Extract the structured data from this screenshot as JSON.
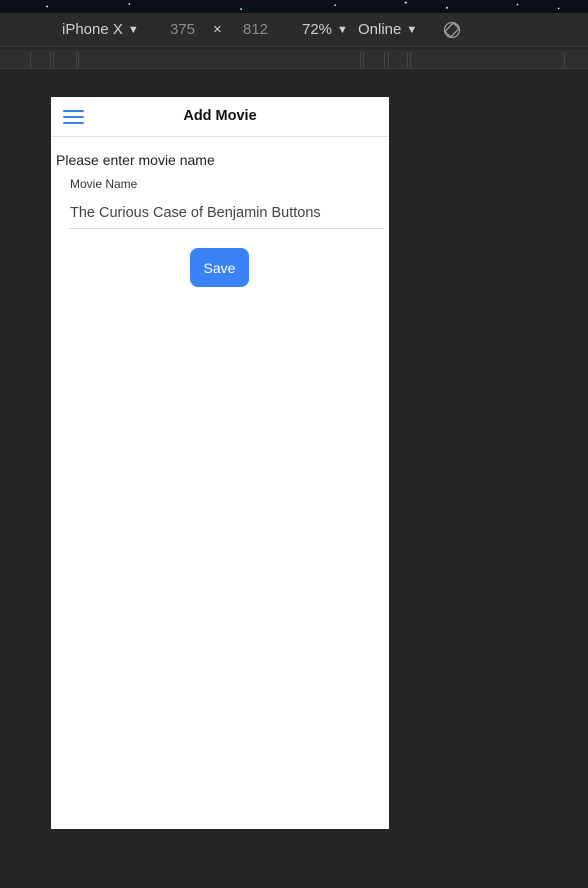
{
  "devtools": {
    "device": "iPhone X",
    "width": "375",
    "times": "×",
    "height": "812",
    "zoom": "72%",
    "network": "Online",
    "caret": "▼"
  },
  "app": {
    "title": "Add Movie",
    "prompt": "Please enter movie name",
    "field_label": "Movie Name",
    "field_value": "The Curious Case of Benjamin Buttons",
    "save_label": "Save"
  },
  "colors": {
    "accent": "#3b82f6",
    "canvas_bg": "#262626"
  }
}
